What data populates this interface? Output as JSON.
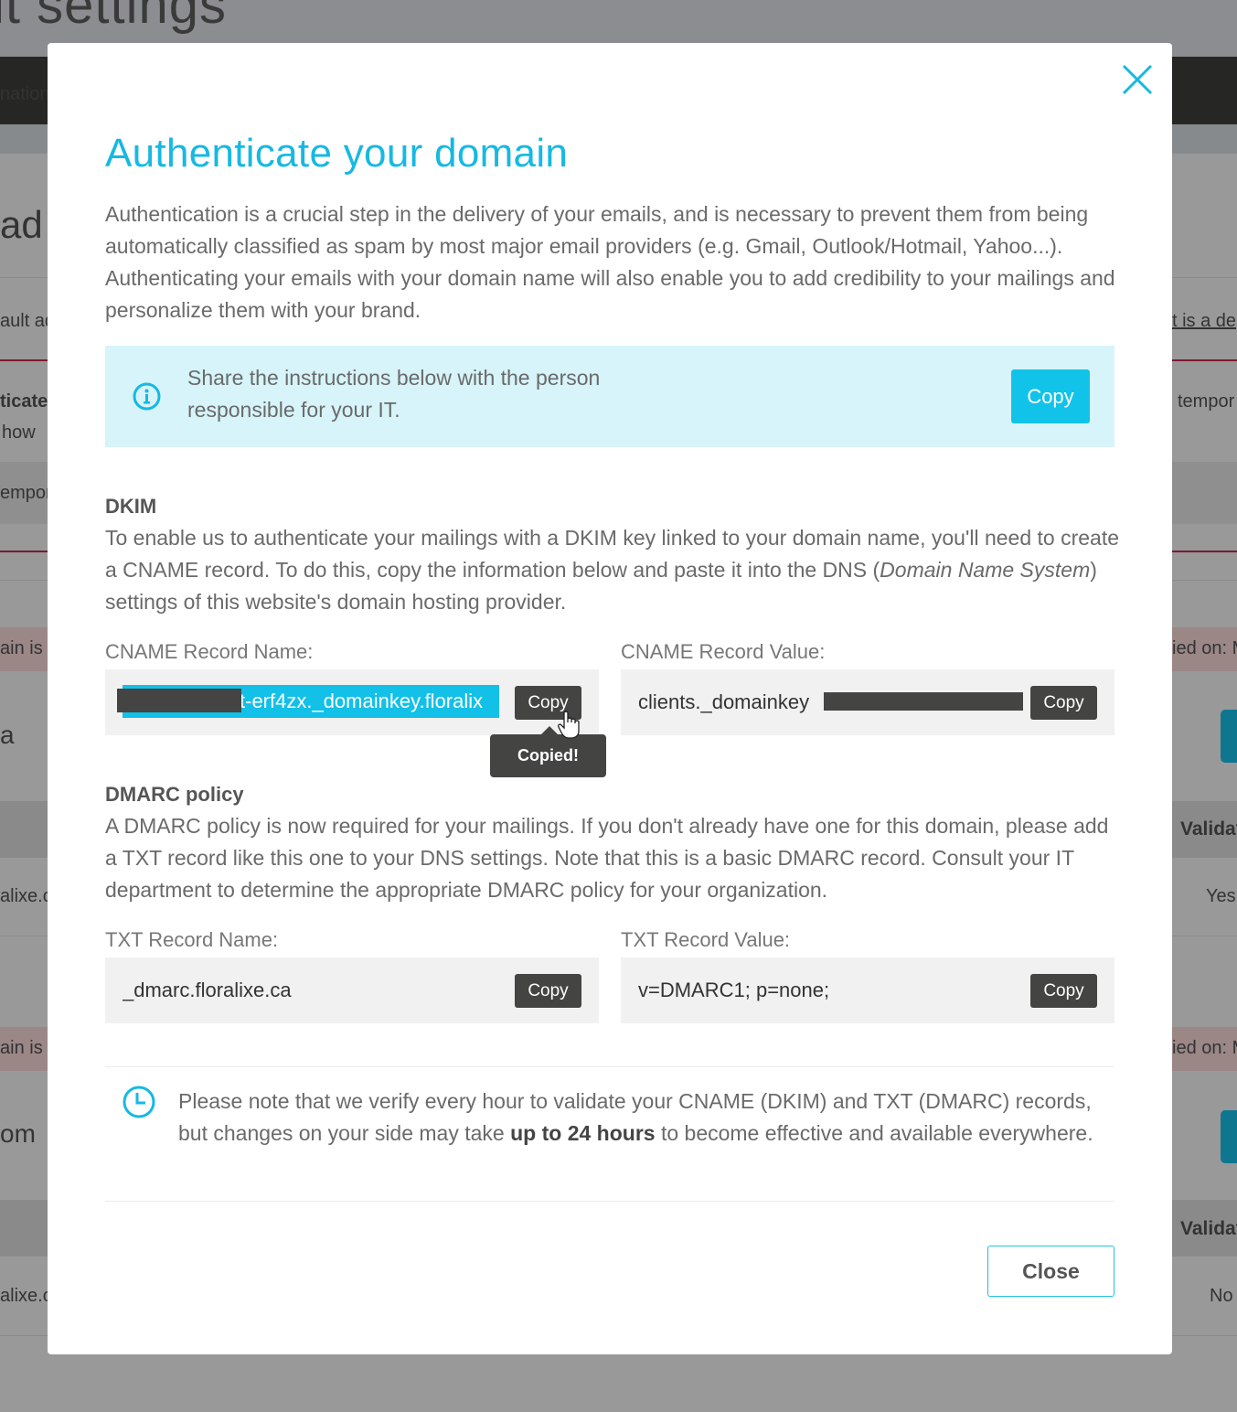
{
  "background": {
    "page_title_fragment": "it settings",
    "nav_item_fragment": "nation",
    "section_heading_fragment": "ad",
    "row_text_1": "ault ad",
    "link_text_right": "t is a de",
    "bold_row_left": "ticate",
    "row_text_2": "how",
    "row_text_3": "empor",
    "row_text_right": "tempor",
    "alert_left": "ain is n",
    "alert_right": "ied on: M",
    "domain_1_fragment": "a",
    "table_header_right": "Validat",
    "table_cell_left_1": "alixe.c",
    "table_cell_right_1": "Yes",
    "domain_2_fragment": "om",
    "table_cell_left_2": "alixe.c",
    "table_cell_right_2": "No"
  },
  "modal": {
    "close_icon": "close-x-icon",
    "title": "Authenticate your domain",
    "intro": "Authentication is a crucial step in the delivery of your emails, and is necessary to prevent them from being automatically classified as spam by most major email providers (e.g. Gmail, Outlook/Hotmail, Yahoo...). Authenticating your emails with your domain name will also enable you to add credibility to your mailings and personalize them with your brand.",
    "info_box": {
      "icon": "info-icon",
      "text": "Share the instructions below with the person responsible for your IT.",
      "copy_label": "Copy"
    },
    "dkim": {
      "heading": "DKIM",
      "text_before": "To enable us to authenticate your mailings with a DKIM key linked to your domain name, you'll need to create a CNAME record. To do this, copy the information below and paste it into the DNS (",
      "text_italic": "Domain Name System",
      "text_after": ") settings of this website's domain hosting provider.",
      "name_label": "CNAME Record Name:",
      "name_value_visible": "t-erf4zx._domainkey.floralix",
      "name_copy_label": "Copy",
      "copied_tooltip": "Copied!",
      "value_label": "CNAME Record Value:",
      "value_visible": "clients._domainkey",
      "value_copy_label": "Copy"
    },
    "dmarc": {
      "heading": "DMARC policy",
      "text": "A DMARC policy is now required for your mailings. If you don't already have one for this domain, please add a TXT record like this one to your DNS settings. Note that this is a basic DMARC record. Consult your IT department to determine the appropriate DMARC policy for your organization.",
      "name_label": "TXT Record Name:",
      "name_value": "_dmarc.floralixe.ca",
      "name_copy_label": "Copy",
      "value_label": "TXT Record Value:",
      "value_value": "v=DMARC1; p=none;",
      "value_copy_label": "Copy"
    },
    "note": {
      "icon": "clock-icon",
      "text_before": "Please note that we verify every hour to validate your CNAME (DKIM) and TXT (DMARC) records, but changes on your side may take ",
      "text_bold": "up to 24 hours",
      "text_after": " to become effective and available everywhere."
    },
    "close_button_label": "Close"
  },
  "colors": {
    "accent": "#16b9e2",
    "info_bg": "#d6f4f9",
    "dark_button": "#444443",
    "overlay": "#999999"
  }
}
